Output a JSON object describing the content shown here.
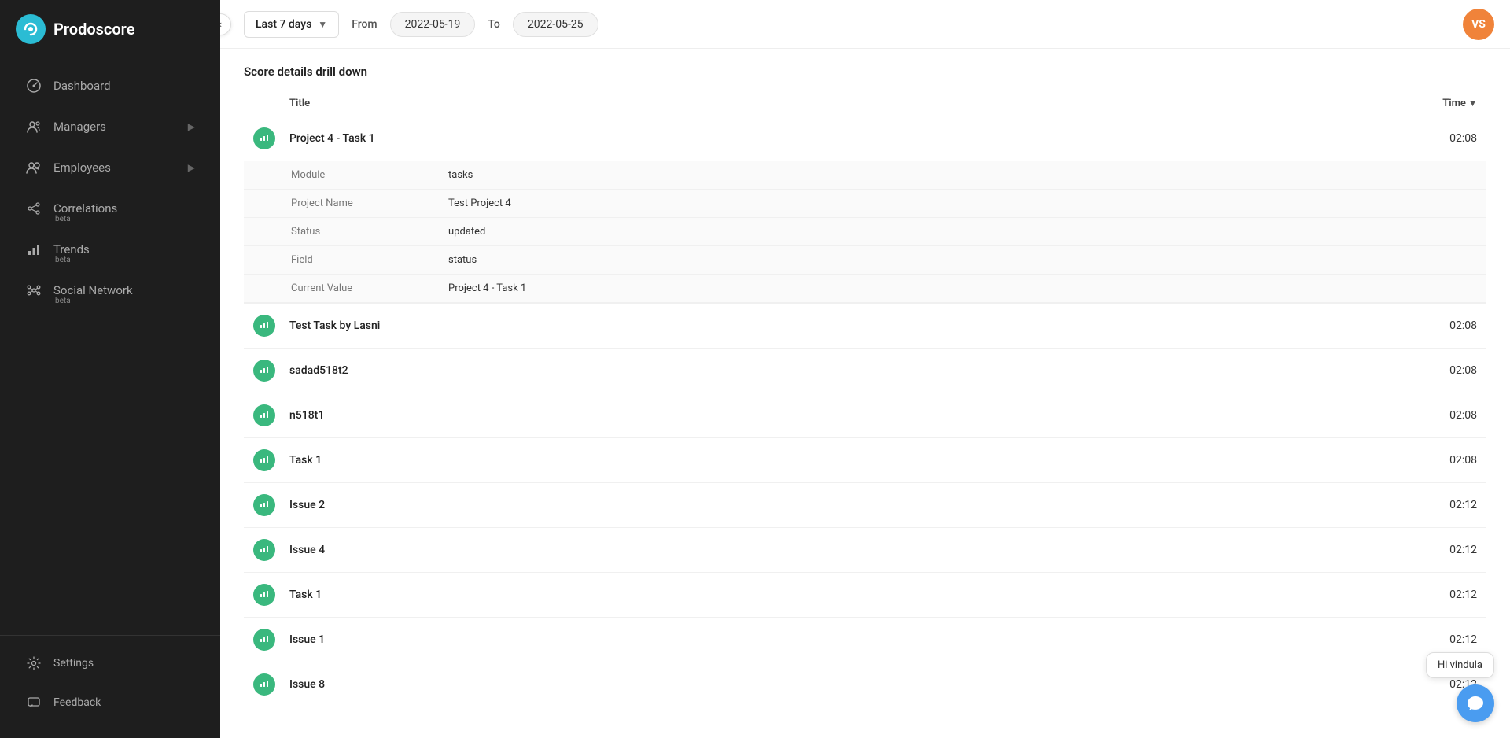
{
  "app": {
    "name": "Prodoscore"
  },
  "sidebar": {
    "nav_items": [
      {
        "id": "dashboard",
        "label": "Dashboard",
        "icon": "dashboard-icon",
        "beta": false,
        "has_arrow": false
      },
      {
        "id": "managers",
        "label": "Managers",
        "icon": "managers-icon",
        "beta": false,
        "has_arrow": true
      },
      {
        "id": "employees",
        "label": "Employees",
        "icon": "employees-icon",
        "beta": false,
        "has_arrow": true
      },
      {
        "id": "correlations",
        "label": "Correlations",
        "icon": "correlations-icon",
        "beta": true,
        "has_arrow": false
      },
      {
        "id": "trends",
        "label": "Trends",
        "icon": "trends-icon",
        "beta": true,
        "has_arrow": false
      },
      {
        "id": "social-network",
        "label": "Social Network",
        "icon": "social-network-icon",
        "beta": true,
        "has_arrow": false
      }
    ],
    "bottom_items": [
      {
        "id": "settings",
        "label": "Settings",
        "icon": "settings-icon"
      },
      {
        "id": "feedback",
        "label": "Feedback",
        "icon": "feedback-icon"
      }
    ]
  },
  "topbar": {
    "date_range_label": "Last 7 days",
    "from_label": "From",
    "from_date": "2022-05-19",
    "to_label": "To",
    "to_date": "2022-05-25",
    "user_initials": "VS"
  },
  "main": {
    "section_title": "Score details drill down",
    "table": {
      "col_title": "Title",
      "col_time": "Time",
      "rows": [
        {
          "id": "row1",
          "title": "Project 4 - Task 1",
          "time": "02:08",
          "expanded": true,
          "details": [
            {
              "label": "Module",
              "value": "tasks"
            },
            {
              "label": "Project Name",
              "value": "Test Project 4"
            },
            {
              "label": "Status",
              "value": "updated"
            },
            {
              "label": "Field",
              "value": "status"
            },
            {
              "label": "Current Value",
              "value": "Project 4 - Task 1"
            }
          ]
        },
        {
          "id": "row2",
          "title": "Test Task by Lasni",
          "time": "02:08",
          "expanded": false,
          "details": []
        },
        {
          "id": "row3",
          "title": "sadad518t2",
          "time": "02:08",
          "expanded": false,
          "details": []
        },
        {
          "id": "row4",
          "title": "n518t1",
          "time": "02:08",
          "expanded": false,
          "details": []
        },
        {
          "id": "row5",
          "title": "Task 1",
          "time": "02:08",
          "expanded": false,
          "details": []
        },
        {
          "id": "row6",
          "title": "Issue 2",
          "time": "02:12",
          "expanded": false,
          "details": []
        },
        {
          "id": "row7",
          "title": "Issue 4",
          "time": "02:12",
          "expanded": false,
          "details": []
        },
        {
          "id": "row8",
          "title": "Task 1",
          "time": "02:12",
          "expanded": false,
          "details": []
        },
        {
          "id": "row9",
          "title": "Issue 1",
          "time": "02:12",
          "expanded": false,
          "details": []
        },
        {
          "id": "row10",
          "title": "Issue 8",
          "time": "02:12",
          "expanded": false,
          "details": []
        }
      ]
    }
  },
  "chat": {
    "bubble_text": "Hi vindula",
    "icon": "chat-icon"
  }
}
